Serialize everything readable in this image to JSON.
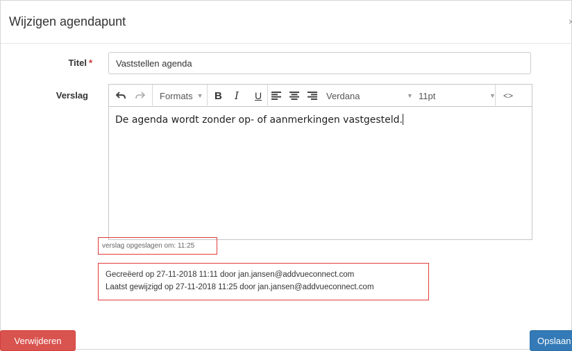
{
  "dialog": {
    "title": "Wijzigen agendapunt",
    "close_label": "×"
  },
  "form": {
    "title_label": "Titel",
    "required_marker": "*",
    "title_value": "Vaststellen agenda",
    "report_label": "Verslag"
  },
  "editor": {
    "toolbar": {
      "formats_label": "Formats",
      "bold_label": "B",
      "italic_label": "I",
      "underline_label": "U",
      "font_family": "Verdana",
      "font_size": "11pt",
      "code_label": "<>"
    },
    "content": "De agenda wordt zonder op- of aanmerkingen vastgesteld."
  },
  "status": {
    "saved_text": "verslag opgeslagen om: 11:25",
    "created_text": "Gecreëerd op 27-11-2018 11:11 door jan.jansen@addvueconnect.com",
    "modified_text": "Laatst gewijzigd op 27-11-2018 11:25 door jan.jansen@addvueconnect.com"
  },
  "buttons": {
    "delete_label": "Verwijderen",
    "save_label": "Opslaan"
  },
  "colors": {
    "danger": "#d9534f",
    "primary": "#337ab7",
    "highlight_border": "#e03a3a",
    "required": "#c9302c"
  }
}
